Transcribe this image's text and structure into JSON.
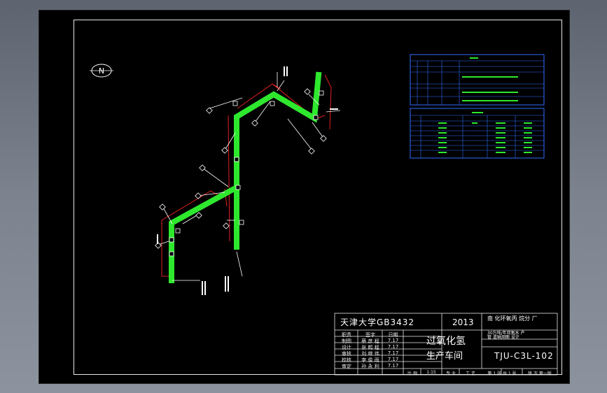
{
  "compass": {
    "label": "N"
  },
  "title_block": {
    "school": "天津大学GB3432",
    "year": "2013",
    "company": "南 化环氧丙 烷分 厂",
    "drawing_title_line1": "过氧化氢",
    "drawing_title_line2": "生产车间",
    "drawing_number": "TJU-C3L-102",
    "project_line1": "30万吨/年双氧水 产",
    "project_line2": "管 道轴测图 设计",
    "header_col1": "职责",
    "header_col2": "签字",
    "header_col3": "日期",
    "rows": [
      {
        "role": "制图",
        "name": "蔡 彦 程",
        "date": "7.17"
      },
      {
        "role": "设计",
        "name": "张 鹤 程",
        "date": "7.17"
      },
      {
        "role": "审核",
        "name": "刘 继 伟",
        "date": "7.17"
      },
      {
        "role": "校核",
        "name": "李 俊 雨",
        "date": "7.17"
      },
      {
        "role": "审定",
        "name": "孙 永 利",
        "date": "7.17"
      }
    ],
    "footer": [
      "比 例",
      "1:15",
      "专 业",
      "工 艺",
      "第 1 张 共 1 张",
      "版 次 第一版"
    ]
  },
  "colors": {
    "pipe": "#2ee82e",
    "dimension": "#e02020",
    "line": "#ffffff",
    "table_border": "#2f6cff",
    "background": "#000000"
  }
}
